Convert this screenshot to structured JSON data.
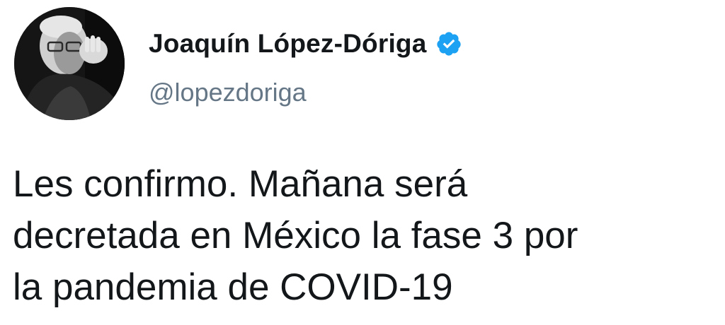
{
  "author": {
    "display_name": "Joaquín López-Dóriga",
    "handle": "@lopezdoriga",
    "verified": true,
    "verified_icon": "verified-badge-icon",
    "avatar_icon": "avatar-photo"
  },
  "tweet": {
    "lines": [
      "Les confirmo. Mañana será",
      "decretada en México la fase 3 por",
      "la pandemia de COVID-19"
    ]
  },
  "colors": {
    "text": "#14171a",
    "handle": "#657786",
    "verified": "#1da1f2"
  }
}
